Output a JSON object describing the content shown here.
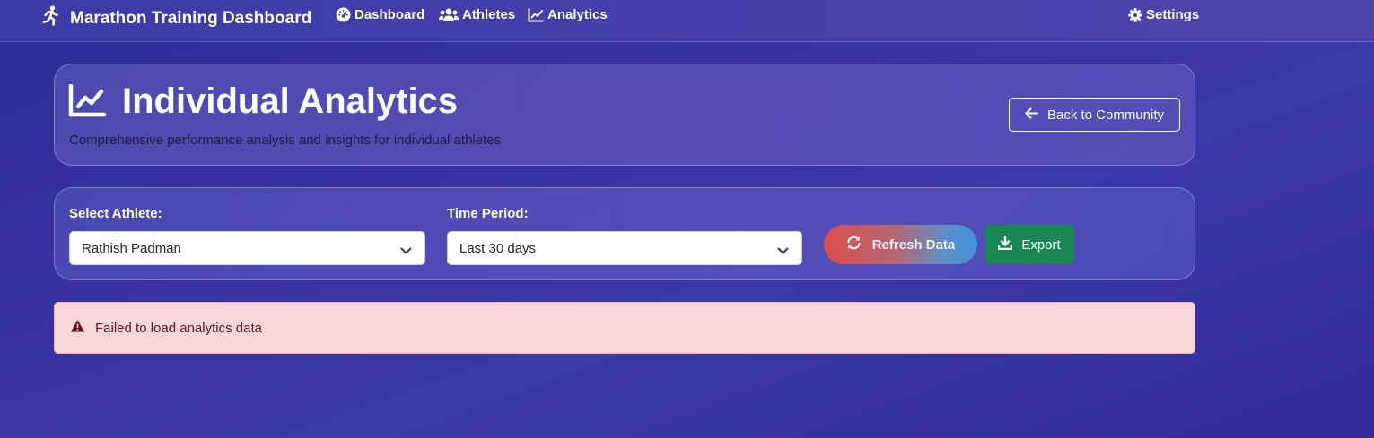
{
  "app": {
    "title": "Marathon Training Dashboard",
    "brand_icon": "running-person-icon"
  },
  "nav": {
    "dashboard": {
      "label": "Dashboard",
      "icon": "tachometer-icon"
    },
    "athletes": {
      "label": "Athletes",
      "icon": "users-icon"
    },
    "analytics": {
      "label": "Analytics",
      "icon": "chart-line-icon"
    },
    "settings": {
      "label": "Settings",
      "icon": "gear-icon"
    }
  },
  "header": {
    "title": "Individual Analytics",
    "subtitle": "Comprehensive performance analysis and insights for individual athletes",
    "back_label": "Back to Community"
  },
  "filters": {
    "athlete_label": "Select Athlete:",
    "athlete_value": "Rathish Padman",
    "period_label": "Time Period:",
    "period_value": "Last 30 days",
    "refresh_label": "Refresh Data",
    "export_label": "Export"
  },
  "alert": {
    "message": "Failed to load analytics data",
    "type": "danger"
  },
  "colors": {
    "export_green": "#198754",
    "alert_bg": "#f8d7da",
    "alert_text": "#58151c"
  }
}
